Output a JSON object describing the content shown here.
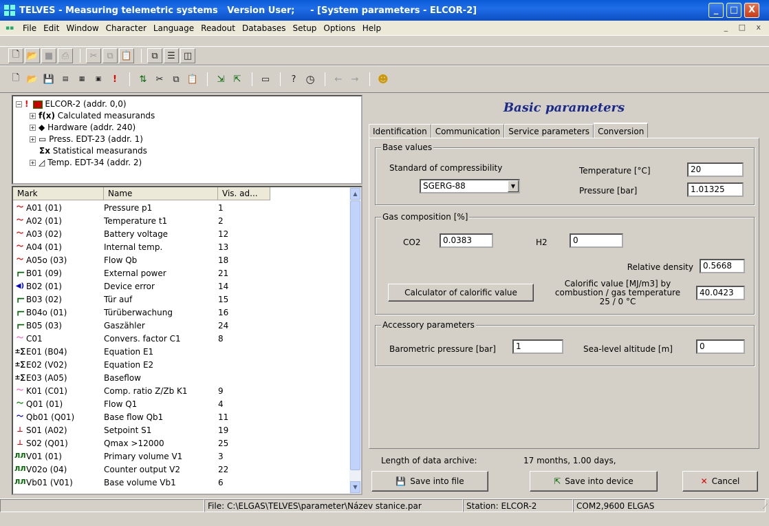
{
  "window": {
    "title": "TELVES - Measuring telemetric systems   Version User;     - [System parameters - ELCOR-2]",
    "minimize": "_",
    "maximize": "□",
    "close": "X"
  },
  "menu": [
    "File",
    "Edit",
    "Window",
    "Character",
    "Language",
    "Readout",
    "Databases",
    "Setup",
    "Options",
    "Help"
  ],
  "mdi_controls": "_ □ x",
  "tree": {
    "root": "ELCOR-2 (addr. 0,0)",
    "children": [
      "Calculated measurands",
      "Hardware (addr. 240)",
      "Press. EDT-23 (addr. 1)",
      "Statistical measurands",
      "Temp. EDT-34 (addr. 2)"
    ]
  },
  "list": {
    "headers": [
      "Mark",
      "Name",
      "Vis. ad..."
    ],
    "rows": [
      {
        "icon": "red-analog-icon",
        "mark": "A01 (01)",
        "name": "Pressure p1",
        "vis": "1"
      },
      {
        "icon": "red-analog-icon",
        "mark": "A02 (01)",
        "name": "Temperature t1",
        "vis": "2"
      },
      {
        "icon": "red-analog-icon",
        "mark": "A03 (02)",
        "name": "Battery voltage",
        "vis": "12"
      },
      {
        "icon": "red-analog-icon",
        "mark": "A04 (01)",
        "name": "Internal temp.",
        "vis": "13"
      },
      {
        "icon": "red-analog-icon",
        "mark": "A05o (03)",
        "name": "Flow Qb",
        "vis": "18"
      },
      {
        "icon": "binary-step-icon",
        "mark": "B01 (09)",
        "name": "External power",
        "vis": "21"
      },
      {
        "icon": "speaker-icon",
        "mark": "B02 (01)",
        "name": "Device error",
        "vis": "14"
      },
      {
        "icon": "binary-step-icon",
        "mark": "B03 (02)",
        "name": "Tür auf",
        "vis": "15"
      },
      {
        "icon": "binary-step-icon",
        "mark": "B04o (01)",
        "name": "Türüberwachung",
        "vis": "16"
      },
      {
        "icon": "binary-step-icon",
        "mark": "B05 (03)",
        "name": "Gaszähler",
        "vis": "24"
      },
      {
        "icon": "pink-analog-icon",
        "mark": "C01",
        "name": "Convers. factor C1",
        "vis": "8"
      },
      {
        "icon": "equation-icon",
        "mark": "E01 (B04)",
        "name": "Equation E1",
        "vis": ""
      },
      {
        "icon": "equation-icon",
        "mark": "E02 (V02)",
        "name": "Equation E2",
        "vis": ""
      },
      {
        "icon": "equation-icon",
        "mark": "E03 (A05)",
        "name": "Baseflow",
        "vis": ""
      },
      {
        "icon": "pink-analog-icon",
        "mark": "K01 (C01)",
        "name": "Comp. ratio Z/Zb K1",
        "vis": "9"
      },
      {
        "icon": "green-analog-icon",
        "mark": "Q01 (01)",
        "name": "Flow Q1",
        "vis": "4"
      },
      {
        "icon": "blue-analog-icon",
        "mark": "Qb01 (Q01)",
        "name": "Base flow Qb1",
        "vis": "11"
      },
      {
        "icon": "setpoint-icon",
        "mark": "S01 (A02)",
        "name": "Setpoint S1",
        "vis": "19"
      },
      {
        "icon": "setpoint-icon",
        "mark": "S02 (Q01)",
        "name": "Qmax >12000",
        "vis": "25"
      },
      {
        "icon": "pulse-icon",
        "mark": "V01 (01)",
        "name": "Primary volume V1",
        "vis": "3"
      },
      {
        "icon": "pulse-icon",
        "mark": "V02o (04)",
        "name": "Counter output V2",
        "vis": "22"
      },
      {
        "icon": "pulse-icon",
        "mark": "Vb01 (V01)",
        "name": "Base volume Vb1",
        "vis": "6"
      }
    ]
  },
  "panel": {
    "title": "Basic parameters",
    "tabs": [
      "Identification",
      "Communication",
      "Service parameters",
      "Conversion"
    ],
    "base": {
      "title": "Base values",
      "standard_label": "Standard of compressibility",
      "standard_value": "SGERG-88",
      "temperature_label": "Temperature [°C]",
      "temperature_value": "20",
      "pressure_label": "Pressure [bar]",
      "pressure_value": "1.01325"
    },
    "gas": {
      "title": "Gas composition [%]",
      "co2_label": "CO2",
      "co2_value": "0.0383",
      "h2_label": "H2",
      "h2_value": "0",
      "density_label": "Relative density",
      "density_value": "0.5668",
      "calc_button": "Calculator of calorific value",
      "calorific_label_1": "Calorific value [MJ/m3] by",
      "calorific_label_2": "combustion / gas temperature",
      "calorific_label_3": "25 / 0 °C",
      "calorific_value": "40.0423"
    },
    "accessory": {
      "title": "Accessory parameters",
      "baro_label": "Barometric pressure [bar]",
      "baro_value": "1",
      "altitude_label": "Sea-level altitude [m]",
      "altitude_value": "0"
    },
    "archive_label": "Length of data archive:",
    "archive_value": "17 months, 1.00 days,",
    "save_file": "Save into file",
    "save_device": "Save into device",
    "cancel": "Cancel"
  },
  "status": {
    "file": "File: C:\\ELGAS\\TELVES\\parameter\\Název stanice.par",
    "station": "Station: ELCOR-2",
    "port": "COM2,9600  ELGAS"
  }
}
